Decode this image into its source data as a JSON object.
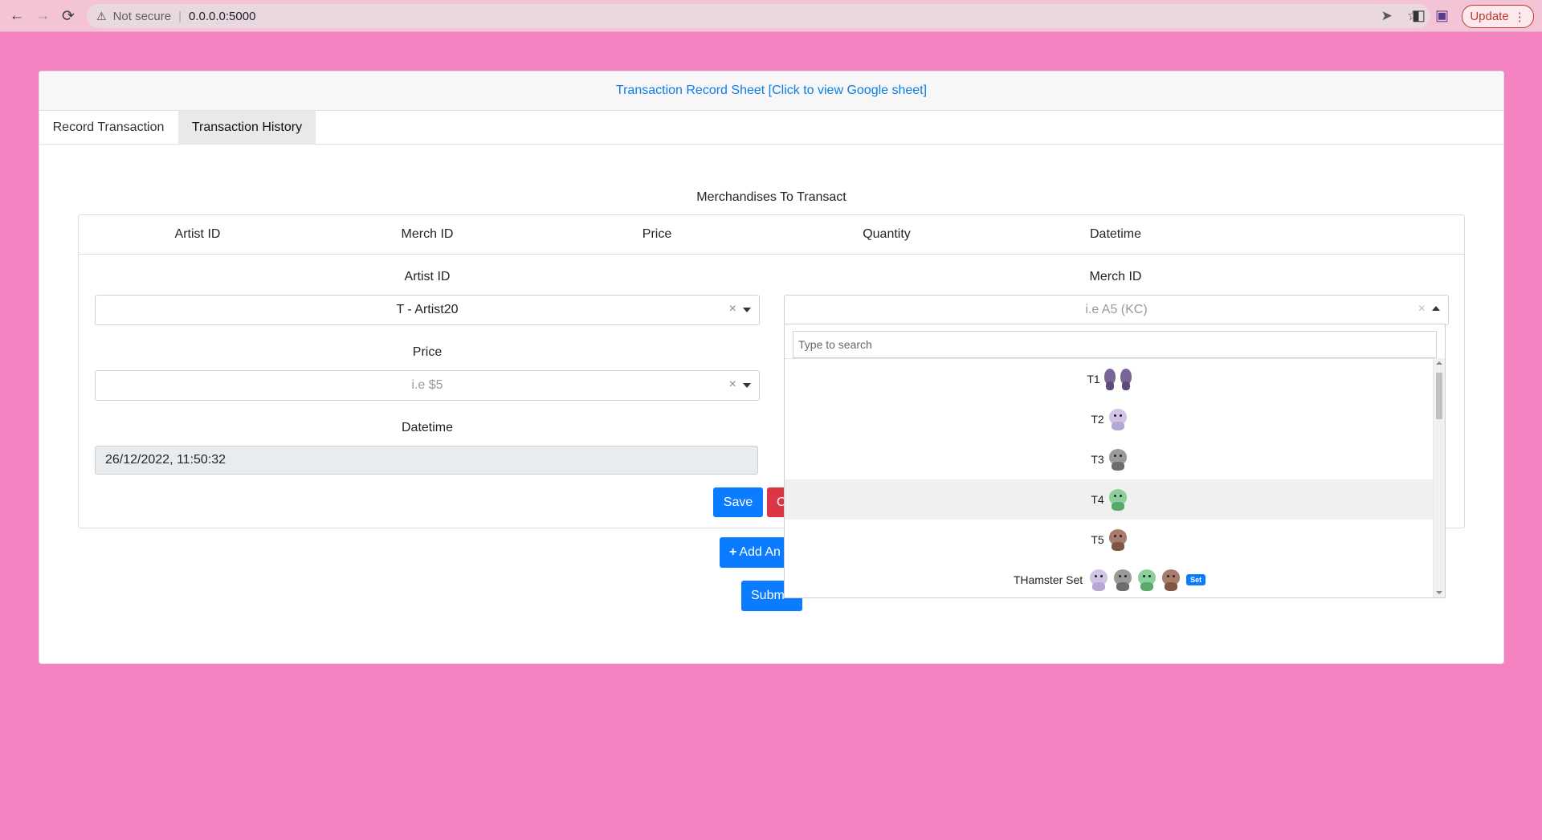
{
  "browser": {
    "security_label": "Not secure",
    "url": "0.0.0.0:5000",
    "update_label": "Update"
  },
  "header": {
    "link_text": "Transaction Record Sheet [Click to view Google sheet]"
  },
  "tabs": [
    {
      "label": "Record Transaction"
    },
    {
      "label": "Transaction History"
    }
  ],
  "form": {
    "section_title": "Merchandises To Transact",
    "columns": [
      "Artist ID",
      "Merch ID",
      "Price",
      "Quantity",
      "Datetime"
    ],
    "artist_label": "Artist ID",
    "artist_value": "T - Artist20",
    "price_label": "Price",
    "price_placeholder": "i.e $5",
    "datetime_label": "Datetime",
    "datetime_value": "26/12/2022, 11:50:32",
    "merch_label": "Merch ID",
    "merch_placeholder": "i.e A5 (KC)",
    "clear_glyph": "×",
    "save_label": "Save",
    "cancel_label": "C",
    "add_label": "Add An",
    "submit_label": "Subm"
  },
  "dropdown": {
    "search_placeholder": "Type to search",
    "options": [
      {
        "label": "T1"
      },
      {
        "label": "T2"
      },
      {
        "label": "T3"
      },
      {
        "label": "T4"
      },
      {
        "label": "T5"
      },
      {
        "label": "THamster Set",
        "badge": "Set"
      }
    ],
    "highlighted_index": 3
  },
  "colors": {
    "page_bg": "#f582c0",
    "link": "#0d7ee8",
    "primary": "#0b7bff",
    "danger": "#dc3545"
  }
}
